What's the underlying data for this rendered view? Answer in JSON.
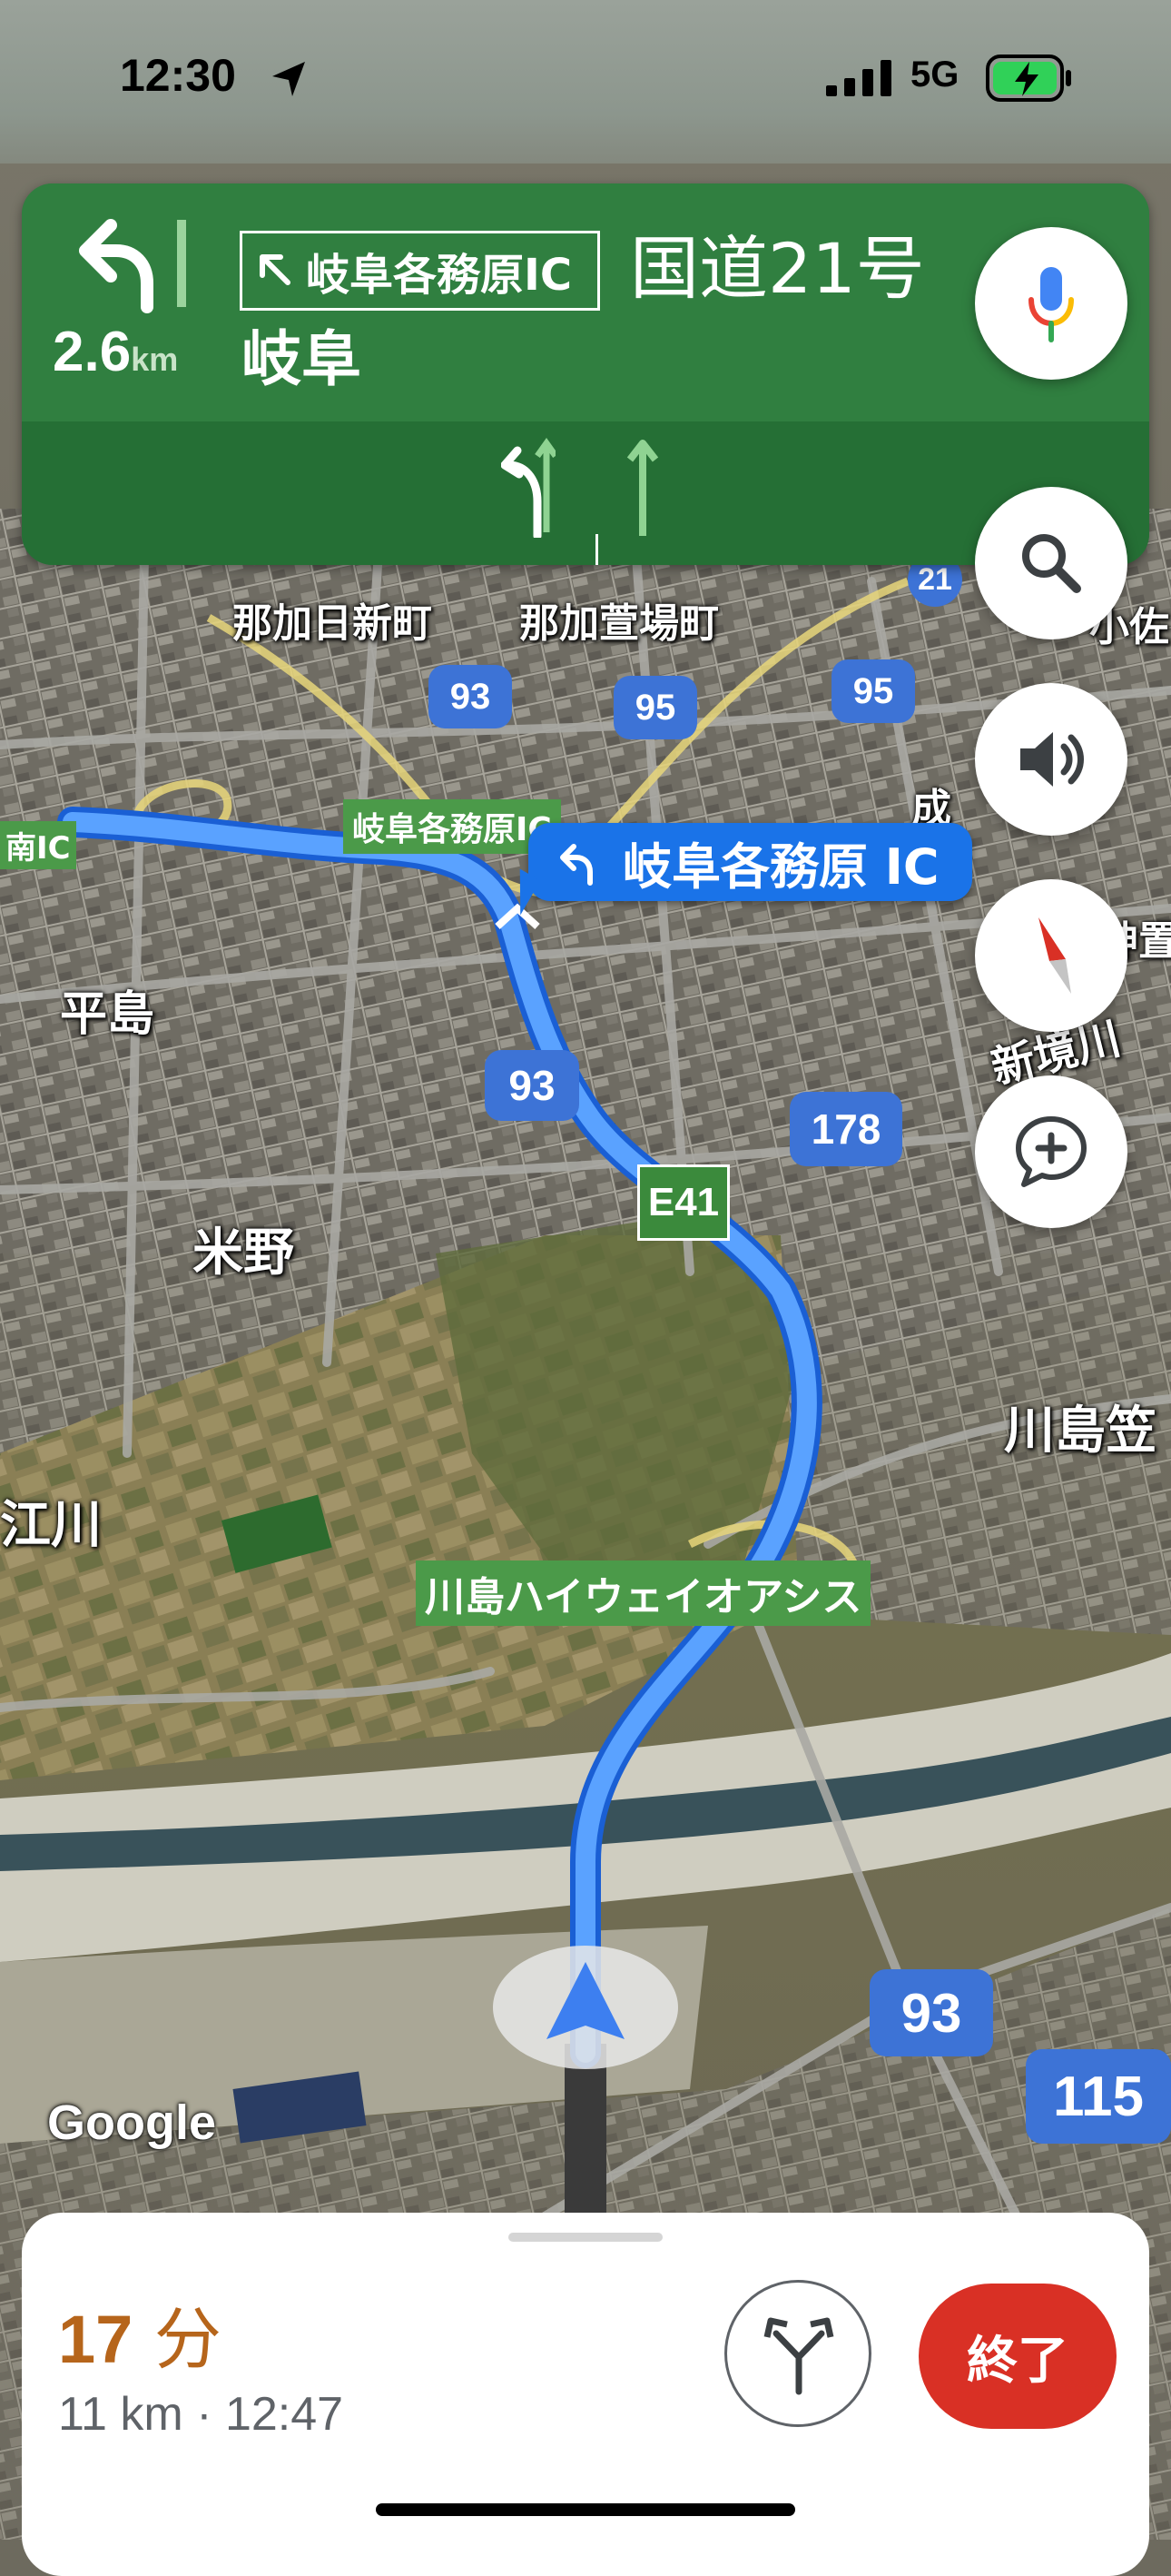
{
  "status_bar": {
    "time": "12:30",
    "network": "5G",
    "icons": [
      "location-arrow-icon",
      "signal-bars-icon",
      "charging-battery-icon"
    ]
  },
  "nav_banner": {
    "distance_value": "2.6",
    "distance_unit": "km",
    "exit_sign": "岐阜各務原IC",
    "route_name": "国道21号",
    "destination": "岐阜",
    "turn_icon": "turn-left-icon",
    "colors": {
      "banner": "#2f7e3f",
      "lanes": "#256f35"
    }
  },
  "map": {
    "callout_label": "岐阜各務原 IC",
    "place_labels": {
      "naka_hi_shin": "那加日新町",
      "naka_kaya": "那加萱場町",
      "hirashima": "平島",
      "yoneno": "米野",
      "kawashima_kasa": "川島笠",
      "edogawa": "江川",
      "shinsakaigawa": "新境川",
      "nari": "成",
      "komu": "小佐",
      "shinmei": "神置",
      "hoku_ic": "南IC"
    },
    "green_labels": {
      "ic_label": "岐阜各務原IC",
      "oasis": "川島ハイウェイオアシス"
    },
    "shields": {
      "r21": "21",
      "r93a": "93",
      "r95a": "95",
      "r95b": "95",
      "r93b": "93",
      "r178": "178",
      "r93c": "93",
      "r115": "115",
      "e41": "E41"
    },
    "attribution": "Google"
  },
  "controls": [
    "mic-icon",
    "search-icon",
    "volume-icon",
    "compass-icon",
    "add-report-icon"
  ],
  "bottom_sheet": {
    "eta_minutes": "17",
    "eta_unit": "分",
    "eta_details": "11 km · 12:47",
    "end_label": "終了",
    "colors": {
      "eta": "#b6651b",
      "end": "#d93025"
    }
  }
}
